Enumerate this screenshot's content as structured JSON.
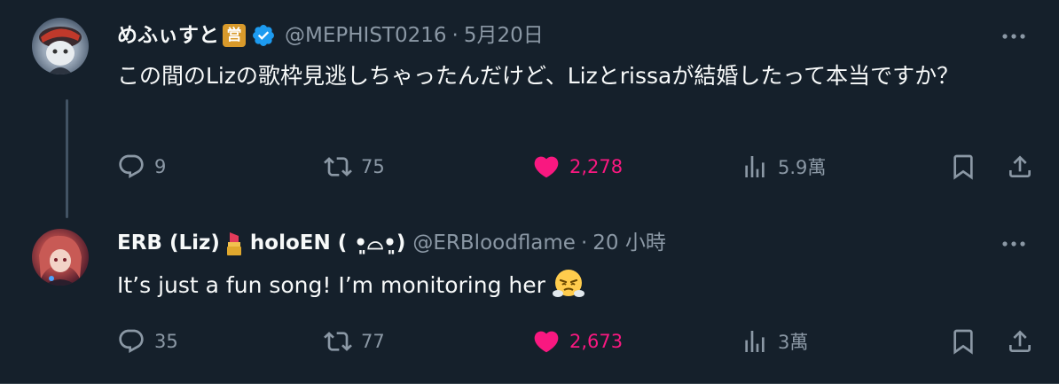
{
  "tweets": [
    {
      "display_name": "めふぃすと",
      "org_badge": "営",
      "handle": "@MEPHIST0216",
      "separator": "·",
      "time": "5月20日",
      "text": "この間のLizの歌枠見逃しちゃったんだけど、Lizとrissaが結婚したって本当ですか？",
      "replies": "9",
      "reposts": "75",
      "likes": "2,278",
      "views": "5.9萬",
      "liked": true
    },
    {
      "display_name": "ERB (Liz)",
      "display_name_suffix": "holoEN",
      "kaomoji": "( •͈⌓•͈)",
      "handle": "@ERBloodflame",
      "separator": "·",
      "time": "20 小時",
      "text": "It’s just a fun song! I’m monitoring her",
      "emoji": "face-with-steam-from-nose",
      "replies": "35",
      "reposts": "77",
      "likes": "2,673",
      "views": "3萬",
      "liked": true
    }
  ],
  "colors": {
    "background": "#15202b",
    "text": "#f7f9f9",
    "muted": "#8b98a5",
    "like": "#f91880",
    "verified": "#1d9bf0",
    "org_badge": "#d99a2b"
  },
  "icons": [
    "more-icon",
    "reply-icon",
    "repost-icon",
    "like-icon",
    "views-icon",
    "bookmark-icon",
    "share-icon",
    "verified-badge-icon",
    "lipstick-emoji",
    "steam-face-emoji"
  ]
}
